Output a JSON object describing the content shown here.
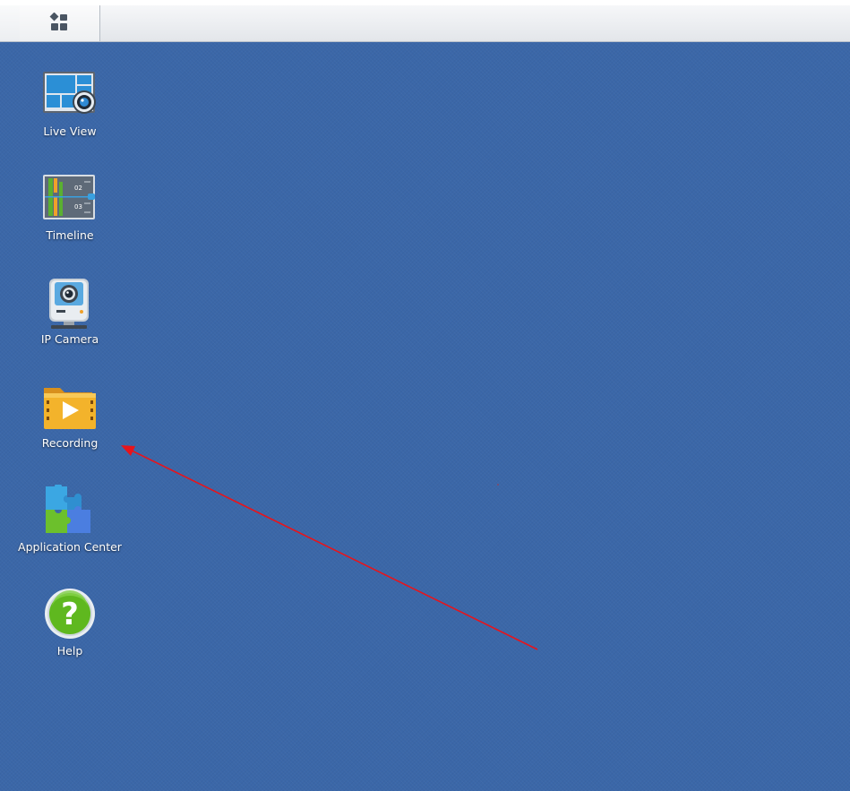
{
  "desktop": {
    "background_color": "#3b67a8",
    "icons": [
      {
        "label": "Live View",
        "icon": "live-view-icon"
      },
      {
        "label": "Timeline",
        "icon": "timeline-icon"
      },
      {
        "label": "IP Camera",
        "icon": "ip-camera-icon"
      },
      {
        "label": "Recording",
        "icon": "recording-icon"
      },
      {
        "label": "Application Center",
        "icon": "application-center-icon"
      },
      {
        "label": "Help",
        "icon": "help-icon"
      }
    ]
  },
  "timeline_icon": {
    "track_1": "02",
    "track_2": "03"
  },
  "taskbar": {
    "menu_icon": "main-menu-icon"
  },
  "annotation": {
    "color": "#e8141b",
    "points_to": "Recording"
  }
}
